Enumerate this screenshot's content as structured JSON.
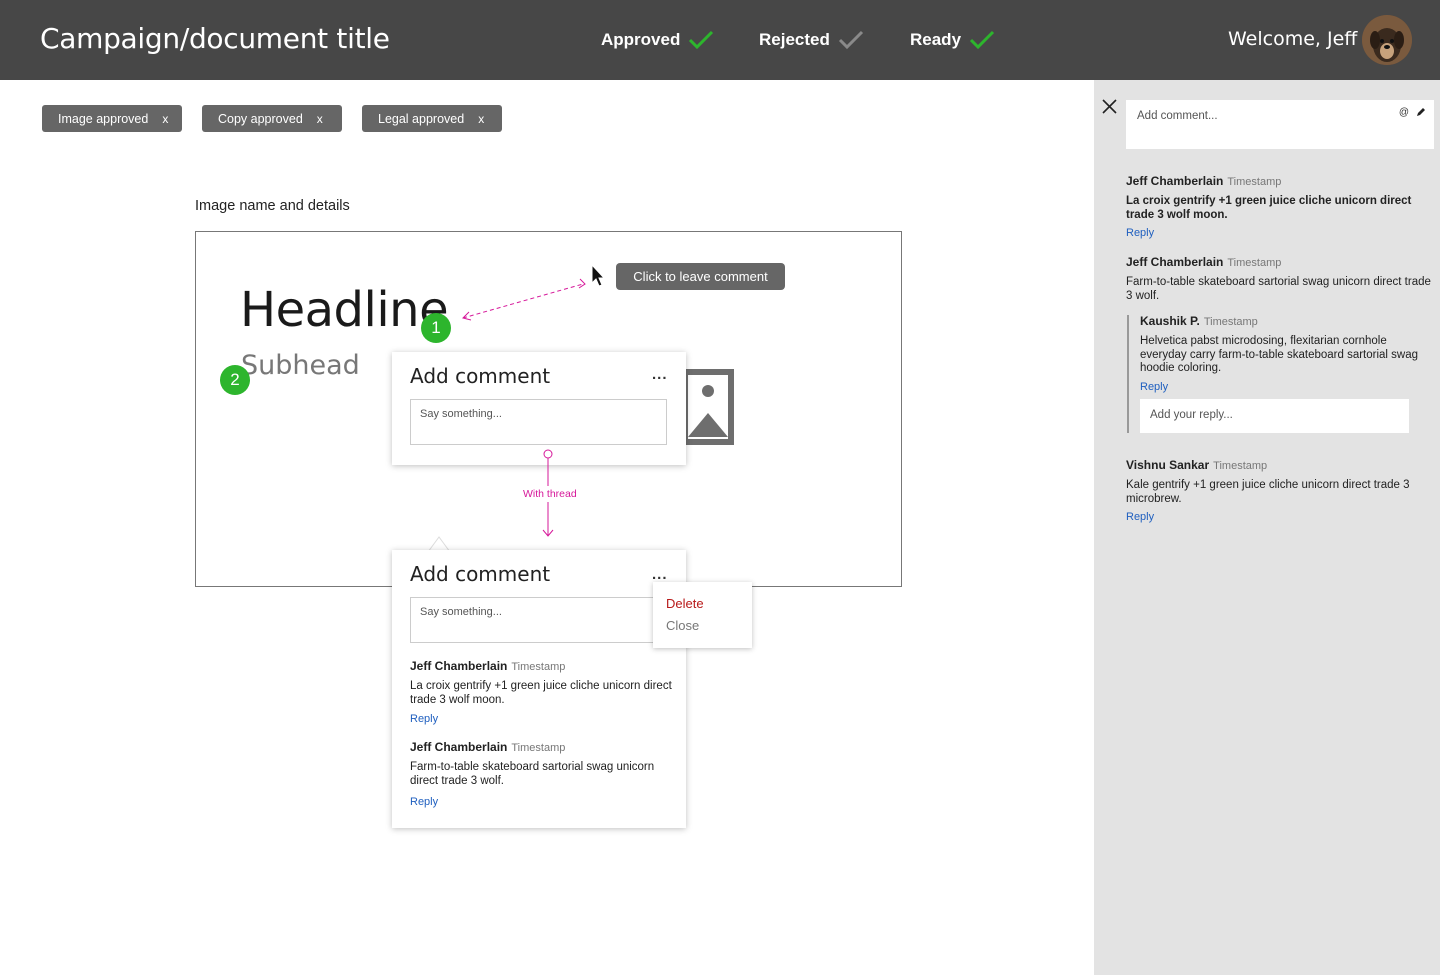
{
  "header": {
    "title": "Campaign/document title",
    "statuses": [
      {
        "label": "Approved",
        "checked": true
      },
      {
        "label": "Rejected",
        "checked": false
      },
      {
        "label": "Ready",
        "checked": true
      }
    ],
    "welcome": "Welcome, Jeff"
  },
  "chips": [
    {
      "label": "Image approved",
      "remove": "x"
    },
    {
      "label": "Copy approved",
      "remove": "x"
    },
    {
      "label": "Legal approved",
      "remove": "x"
    }
  ],
  "canvas": {
    "label": "Image name and details",
    "headline": "Headline",
    "subhead": "Subhead",
    "pins": [
      "1",
      "2"
    ],
    "tooltip": "Click to leave comment",
    "annotation": "With thread"
  },
  "comment_card": {
    "title": "Add comment",
    "more": "...",
    "placeholder": "Say something..."
  },
  "thread_card": {
    "title": "Add comment",
    "more": "...",
    "placeholder": "Say something...",
    "menu": {
      "delete": "Delete",
      "close": "Close"
    },
    "comments": [
      {
        "author": "Jeff Chamberlain",
        "time": "Timestamp",
        "text": "La croix gentrify +1 green juice cliche unicorn direct trade 3 wolf moon.",
        "reply": "Reply"
      },
      {
        "author": "Jeff Chamberlain",
        "time": "Timestamp",
        "text": "Farm-to-table skateboard sartorial swag unicorn direct trade 3 wolf.",
        "reply": "Reply"
      }
    ]
  },
  "sidebar": {
    "add_comment_placeholder": "Add comment...",
    "icons": [
      "at-icon",
      "pencil-icon"
    ],
    "comments": [
      {
        "author": "Jeff Chamberlain",
        "time": "Timestamp",
        "text": "La croix gentrify +1 green juice cliche unicorn direct trade 3 wolf moon.",
        "reply": "Reply"
      },
      {
        "author": "Jeff Chamberlain",
        "time": "Timestamp",
        "text": "Farm-to-table skateboard sartorial swag unicorn direct trade 3 wolf.",
        "reply": null
      },
      {
        "author": "Kaushik P.",
        "time": "Timestamp",
        "text": "Helvetica pabst microdosing, flexitarian cornhole everyday carry farm-to-table skateboard sartorial swag hoodie coloring.",
        "reply": "Reply"
      },
      {
        "author": "Vishnu Sankar",
        "time": "Timestamp",
        "text": "Kale gentrify +1 green juice cliche unicorn direct trade 3 microbrew.",
        "reply": "Reply"
      }
    ],
    "reply_placeholder": "Add your reply..."
  },
  "colors": {
    "topbar": "#474747",
    "check_green": "#2db52d",
    "pin_green": "#2db52d",
    "annotation_pink": "#d6189a",
    "link_blue": "#1f5fbf",
    "delete_red": "#b81a1a",
    "sidebar_bg": "#e3e3e3"
  }
}
